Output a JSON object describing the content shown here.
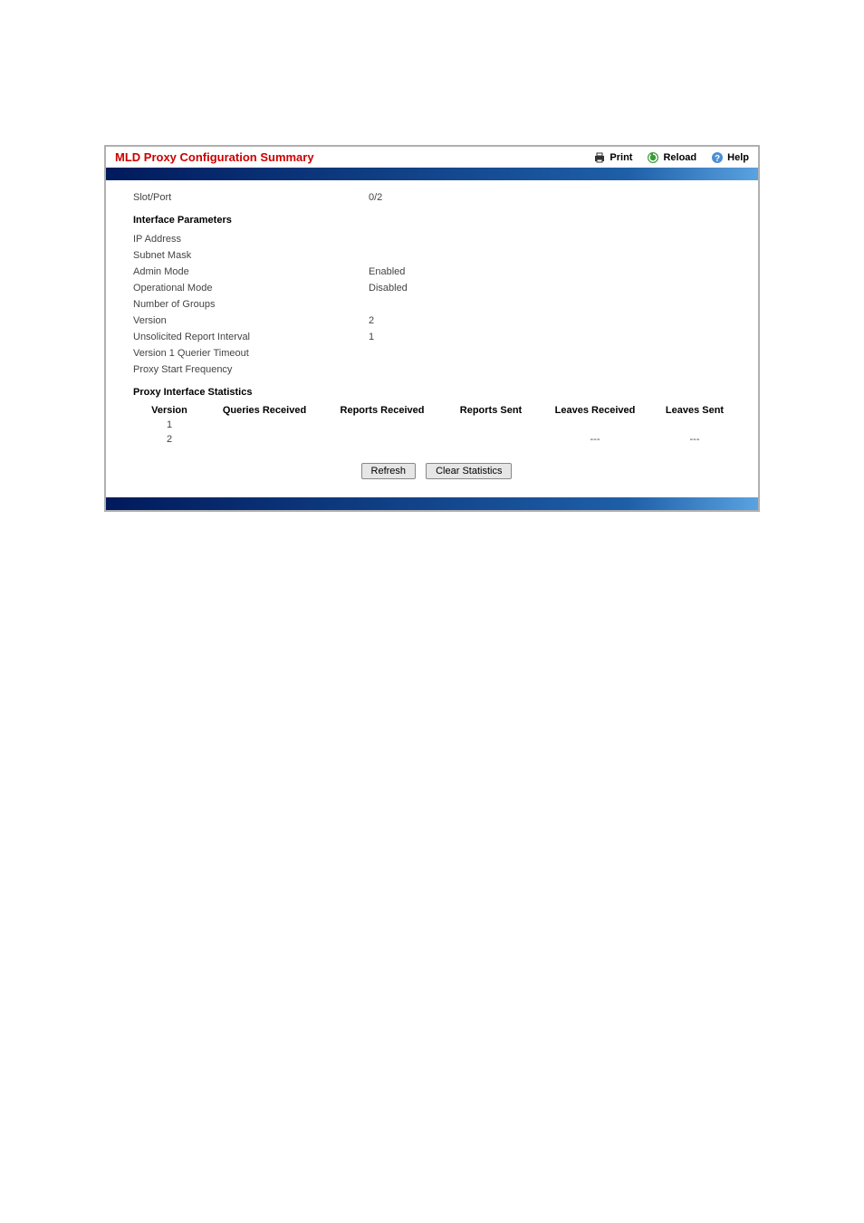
{
  "header": {
    "title": "MLD Proxy Configuration Summary",
    "print": "Print",
    "reload": "Reload",
    "help": "Help"
  },
  "slotport": {
    "label": "Slot/Port",
    "value": "0/2"
  },
  "sections": {
    "interface_params": "Interface Parameters",
    "proxy_stats": "Proxy Interface Statistics"
  },
  "params": {
    "ip_address": {
      "label": "IP Address",
      "value": ""
    },
    "subnet_mask": {
      "label": "Subnet Mask",
      "value": ""
    },
    "admin_mode": {
      "label": "Admin Mode",
      "value": "Enabled"
    },
    "operational_mode": {
      "label": "Operational Mode",
      "value": "Disabled"
    },
    "number_of_groups": {
      "label": "Number of Groups",
      "value": ""
    },
    "version": {
      "label": "Version",
      "value": "2"
    },
    "unsolicited_report_interval": {
      "label": "Unsolicited Report Interval",
      "value": "1"
    },
    "v1_querier_timeout": {
      "label": "Version 1 Querier Timeout",
      "value": ""
    },
    "proxy_start_frequency": {
      "label": "Proxy Start Frequency",
      "value": ""
    }
  },
  "stats": {
    "headers": {
      "version": "Version",
      "queries_received": "Queries Received",
      "reports_received": "Reports Received",
      "reports_sent": "Reports Sent",
      "leaves_received": "Leaves Received",
      "leaves_sent": "Leaves Sent"
    },
    "rows": [
      {
        "version": "1",
        "qr": "",
        "rr": "",
        "rs": "",
        "lr": "",
        "ls": ""
      },
      {
        "version": "2",
        "qr": "",
        "rr": "",
        "rs": "",
        "lr": "---",
        "ls": "---"
      }
    ]
  },
  "buttons": {
    "refresh": "Refresh",
    "clear": "Clear Statistics"
  }
}
